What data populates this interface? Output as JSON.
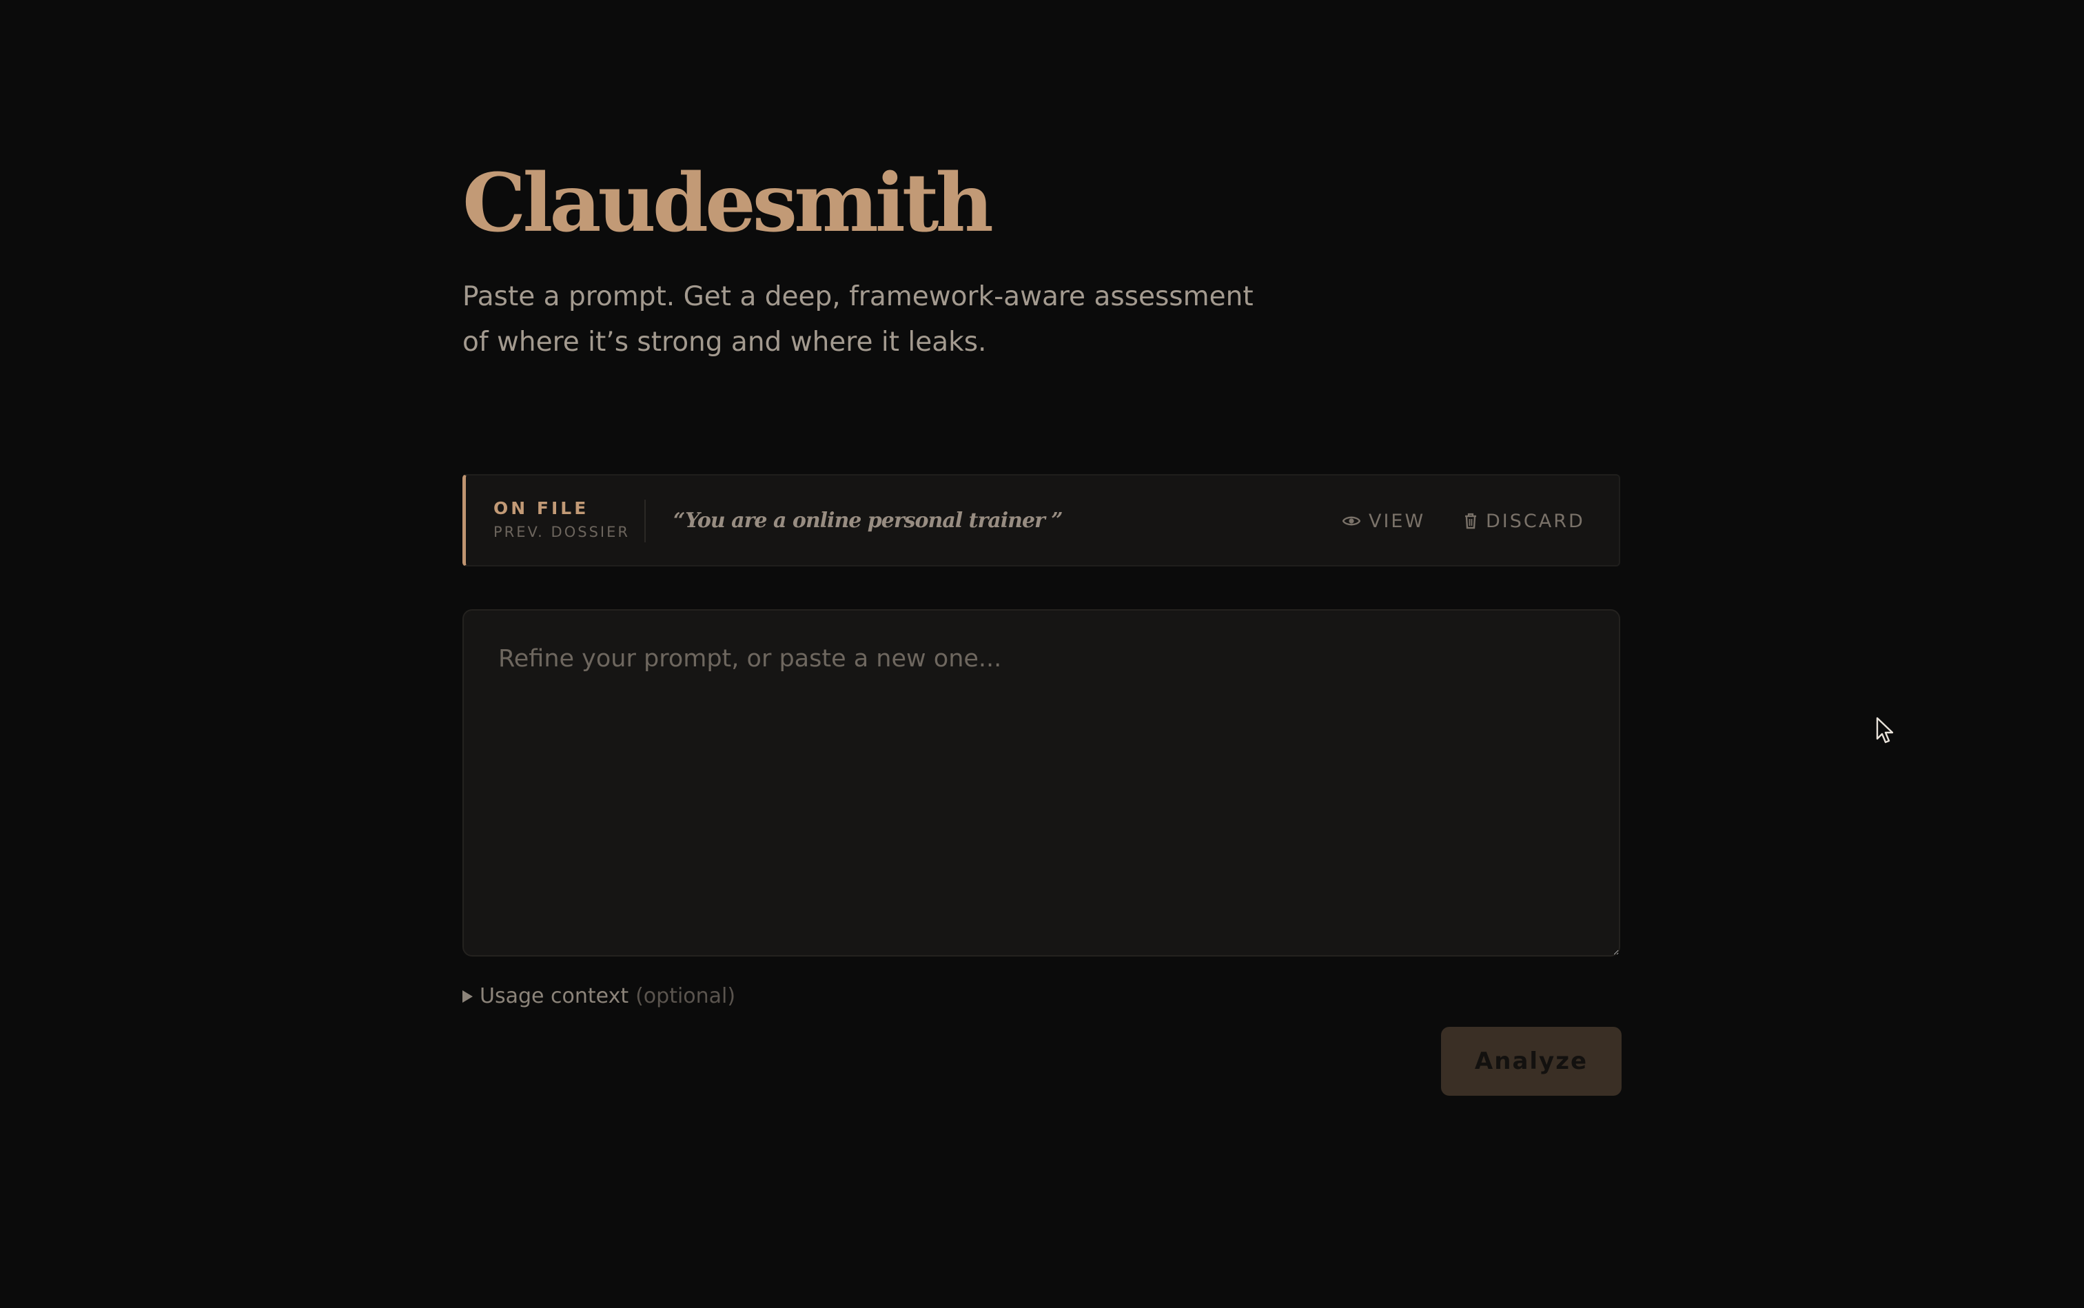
{
  "header": {
    "title": "Claudesmith",
    "subtitle_line1": "Paste a prompt. Get a deep, framework-aware assessment",
    "subtitle_line2": "of where it’s strong and where it leaks."
  },
  "on_file": {
    "tag": "ON FILE",
    "sub_tag": "PREV. DOSSIER",
    "quote": "“You are a online personal trainer ”",
    "view_label": "VIEW",
    "view_icon": "eye-icon",
    "discard_label": "DISCARD",
    "discard_icon": "trash-icon",
    "accent_color": "#bf9470"
  },
  "prompt": {
    "value": "",
    "placeholder": "Refine your prompt, or paste a new one..."
  },
  "usage_context": {
    "label": "Usage context",
    "optional_label": "(optional)",
    "expanded": false
  },
  "actions": {
    "analyze_label": "Analyze"
  },
  "theme": {
    "background": "#0b0b0b",
    "accent": "#c29a76",
    "button_bg": "#3a2f25"
  }
}
